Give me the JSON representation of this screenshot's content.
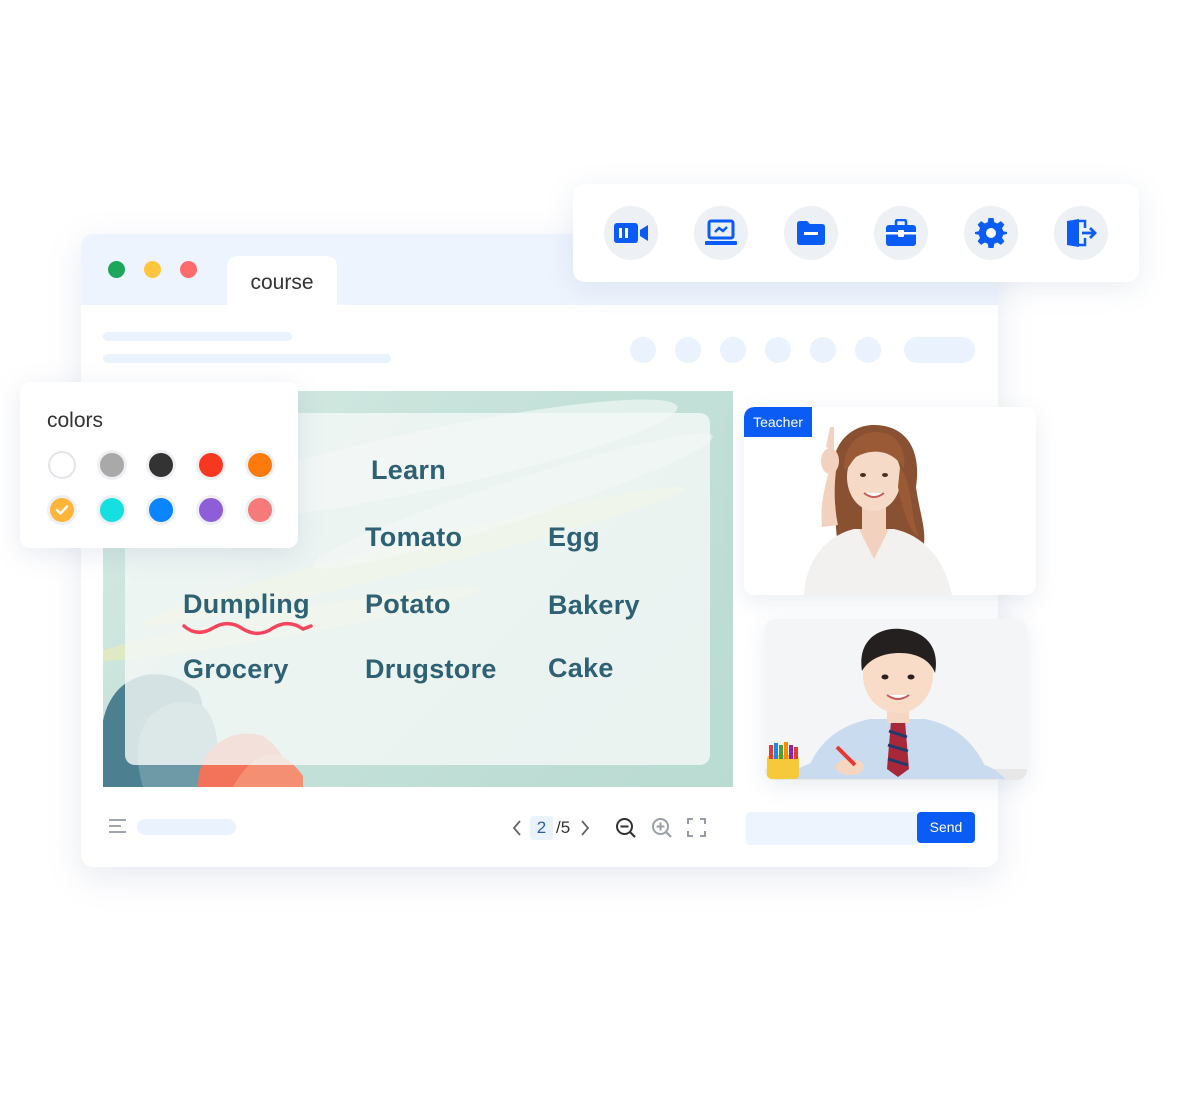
{
  "window": {
    "tab_label": "course",
    "traffic_lights": [
      "#1ea75a",
      "#ffc53d",
      "#ff6b6b"
    ]
  },
  "slide": {
    "words": [
      {
        "text": "Learn"
      },
      {
        "text": "Tomato"
      },
      {
        "text": "Egg"
      },
      {
        "text": "Dumpling"
      },
      {
        "text": "Potato"
      },
      {
        "text": "Bakery"
      },
      {
        "text": "Grocery"
      },
      {
        "text": "Drugstore"
      },
      {
        "text": "Cake"
      }
    ],
    "underline_color": "#f5455c",
    "word_color": "#2d6173"
  },
  "pager": {
    "current": "2",
    "total": "/5"
  },
  "chat": {
    "input_value": "",
    "send_label": "Send"
  },
  "toolbar": {
    "tools": [
      "video-camera-icon",
      "screen-share-icon",
      "folder-icon",
      "toolbox-icon",
      "settings-gear-icon",
      "exit-icon"
    ],
    "accent": "#0a5cf5"
  },
  "colors_panel": {
    "title": "colors",
    "swatches": [
      "#ffffff",
      "#a9a9a9",
      "#333333",
      "#f5381f",
      "#ff7a0a",
      "#ffb43a",
      "#14e0e0",
      "#0a84ff",
      "#8e5ed8",
      "#f57a7a"
    ],
    "selected": "#ffb43a"
  },
  "videos": {
    "teacher_label": "Teacher"
  }
}
